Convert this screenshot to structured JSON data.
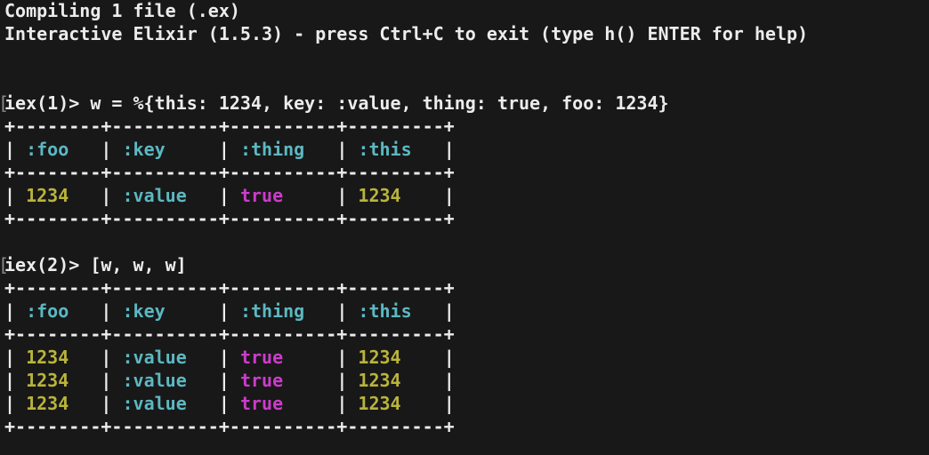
{
  "colors": {
    "background": "#181818",
    "default": "#ececec",
    "atom": "#5cb8c2",
    "number": "#b9b43c",
    "boolean": "#cc3ccc"
  },
  "lines": [
    {
      "segments": [
        {
          "text": "Compiling 1 file (.ex)",
          "color": "default"
        }
      ]
    },
    {
      "segments": [
        {
          "text": "Interactive Elixir (1.5.3) - press Ctrl+C to exit (type h() ENTER for help)",
          "color": "default"
        }
      ]
    },
    {
      "segments": []
    },
    {
      "segments": []
    },
    {
      "prompt": true,
      "segments": [
        {
          "text": "iex(1)> w = %{this: 1234, key: :value, thing: true, foo: 1234}",
          "color": "default"
        }
      ]
    },
    {
      "segments": [
        {
          "text": "+--------+----------+----------+---------+",
          "color": "default"
        }
      ]
    },
    {
      "segments": [
        {
          "text": "| ",
          "color": "default"
        },
        {
          "text": ":foo",
          "color": "cyan"
        },
        {
          "text": "   | ",
          "color": "default"
        },
        {
          "text": ":key",
          "color": "cyan"
        },
        {
          "text": "     | ",
          "color": "default"
        },
        {
          "text": ":thing",
          "color": "cyan"
        },
        {
          "text": "   | ",
          "color": "default"
        },
        {
          "text": ":this",
          "color": "cyan"
        },
        {
          "text": "   |",
          "color": "default"
        }
      ]
    },
    {
      "segments": [
        {
          "text": "+--------+----------+----------+---------+",
          "color": "default"
        }
      ]
    },
    {
      "segments": [
        {
          "text": "| ",
          "color": "default"
        },
        {
          "text": "1234",
          "color": "yellow"
        },
        {
          "text": "   | ",
          "color": "default"
        },
        {
          "text": ":value",
          "color": "cyan"
        },
        {
          "text": "   | ",
          "color": "default"
        },
        {
          "text": "true",
          "color": "magenta"
        },
        {
          "text": "     | ",
          "color": "default"
        },
        {
          "text": "1234",
          "color": "yellow"
        },
        {
          "text": "    |",
          "color": "default"
        }
      ]
    },
    {
      "segments": [
        {
          "text": "+--------+----------+----------+---------+",
          "color": "default"
        }
      ]
    },
    {
      "segments": []
    },
    {
      "prompt": true,
      "segments": [
        {
          "text": "iex(2)> [w, w, w]",
          "color": "default"
        }
      ]
    },
    {
      "segments": [
        {
          "text": "+--------+----------+----------+---------+",
          "color": "default"
        }
      ]
    },
    {
      "segments": [
        {
          "text": "| ",
          "color": "default"
        },
        {
          "text": ":foo",
          "color": "cyan"
        },
        {
          "text": "   | ",
          "color": "default"
        },
        {
          "text": ":key",
          "color": "cyan"
        },
        {
          "text": "     | ",
          "color": "default"
        },
        {
          "text": ":thing",
          "color": "cyan"
        },
        {
          "text": "   | ",
          "color": "default"
        },
        {
          "text": ":this",
          "color": "cyan"
        },
        {
          "text": "   |",
          "color": "default"
        }
      ]
    },
    {
      "segments": [
        {
          "text": "+--------+----------+----------+---------+",
          "color": "default"
        }
      ]
    },
    {
      "segments": [
        {
          "text": "| ",
          "color": "default"
        },
        {
          "text": "1234",
          "color": "yellow"
        },
        {
          "text": "   | ",
          "color": "default"
        },
        {
          "text": ":value",
          "color": "cyan"
        },
        {
          "text": "   | ",
          "color": "default"
        },
        {
          "text": "true",
          "color": "magenta"
        },
        {
          "text": "     | ",
          "color": "default"
        },
        {
          "text": "1234",
          "color": "yellow"
        },
        {
          "text": "    |",
          "color": "default"
        }
      ]
    },
    {
      "segments": [
        {
          "text": "| ",
          "color": "default"
        },
        {
          "text": "1234",
          "color": "yellow"
        },
        {
          "text": "   | ",
          "color": "default"
        },
        {
          "text": ":value",
          "color": "cyan"
        },
        {
          "text": "   | ",
          "color": "default"
        },
        {
          "text": "true",
          "color": "magenta"
        },
        {
          "text": "     | ",
          "color": "default"
        },
        {
          "text": "1234",
          "color": "yellow"
        },
        {
          "text": "    |",
          "color": "default"
        }
      ]
    },
    {
      "segments": [
        {
          "text": "| ",
          "color": "default"
        },
        {
          "text": "1234",
          "color": "yellow"
        },
        {
          "text": "   | ",
          "color": "default"
        },
        {
          "text": ":value",
          "color": "cyan"
        },
        {
          "text": "   | ",
          "color": "default"
        },
        {
          "text": "true",
          "color": "magenta"
        },
        {
          "text": "     | ",
          "color": "default"
        },
        {
          "text": "1234",
          "color": "yellow"
        },
        {
          "text": "    |",
          "color": "default"
        }
      ]
    },
    {
      "segments": [
        {
          "text": "+--------+----------+----------+---------+",
          "color": "default"
        }
      ]
    }
  ],
  "cursor_mark": "["
}
